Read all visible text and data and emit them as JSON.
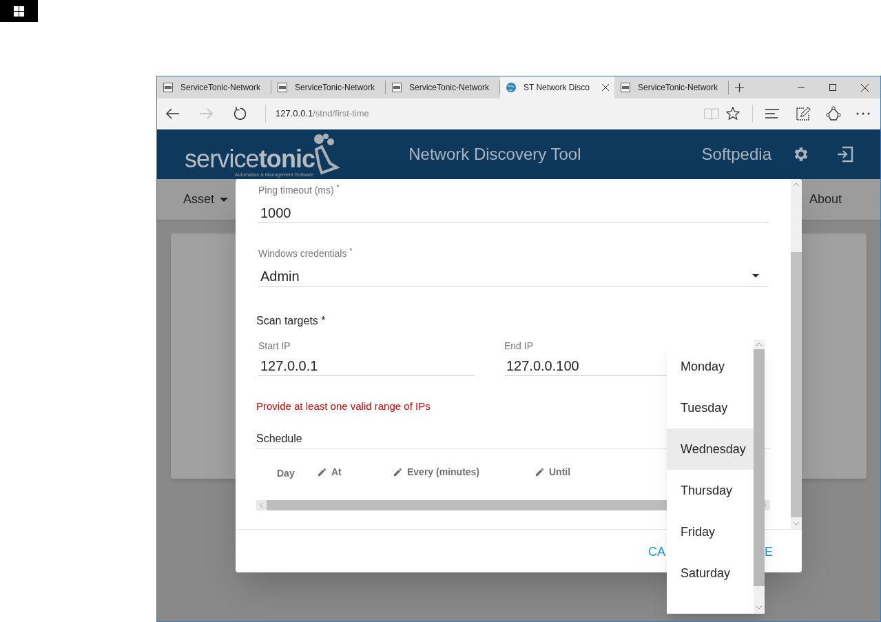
{
  "browser": {
    "tabs": [
      {
        "title": "ServiceTonic-Network",
        "kind": "pdf",
        "selected": false
      },
      {
        "title": "ServiceTonic-Network",
        "kind": "pdf",
        "selected": false
      },
      {
        "title": "ServiceTonic-Network",
        "kind": "pdf",
        "selected": false
      },
      {
        "title": "ST Network Disco",
        "kind": "web",
        "selected": true
      },
      {
        "title": "ServiceTonic-Network",
        "kind": "pdf",
        "selected": false
      }
    ],
    "address": {
      "host": "127.0.0.1",
      "path": "/stnd/first-time"
    }
  },
  "header": {
    "logo": "service**tonic**",
    "logo_tagline": "Automation & Management Software",
    "title": "Network Discovery Tool",
    "user": "Softpedia"
  },
  "nav": [
    {
      "label": "Asset",
      "dropdown": true
    },
    {
      "label": "About",
      "dropdown": false
    }
  ],
  "dialog": {
    "fields": [
      {
        "kind": "text",
        "label": "Ping timeout (ms) $^{*}$",
        "value": "1000"
      },
      {
        "kind": "select",
        "label": "Windows credentials $^{*}$",
        "value": "Admin"
      }
    ],
    "scan_targets": {
      "title": "Scan targets *",
      "start": {
        "label": "Start IP",
        "value": "127.0.0.1"
      },
      "end": {
        "label": "End IP",
        "value": "127.0.0.100"
      }
    },
    "error": "Provide at least one valid range of IPs",
    "schedule": {
      "title": "Schedule",
      "columns": [
        {
          "label": "Day",
          "editable": false
        },
        {
          "label": "At",
          "editable": true
        },
        {
          "label": "Every (minutes)",
          "editable": true
        },
        {
          "label": "Until",
          "editable": true
        }
      ]
    },
    "buttons": [
      {
        "label": "CA",
        "kind": "cancel"
      },
      {
        "label": "E",
        "kind": "save"
      }
    ]
  },
  "day_dropdown": {
    "options": [
      {
        "label": "Monday",
        "selected": false
      },
      {
        "label": "Tuesday",
        "selected": false
      },
      {
        "label": "Wednesday",
        "selected": true
      },
      {
        "label": "Thursday",
        "selected": false
      },
      {
        "label": "Friday",
        "selected": false
      },
      {
        "label": "Saturday",
        "selected": false
      }
    ]
  }
}
